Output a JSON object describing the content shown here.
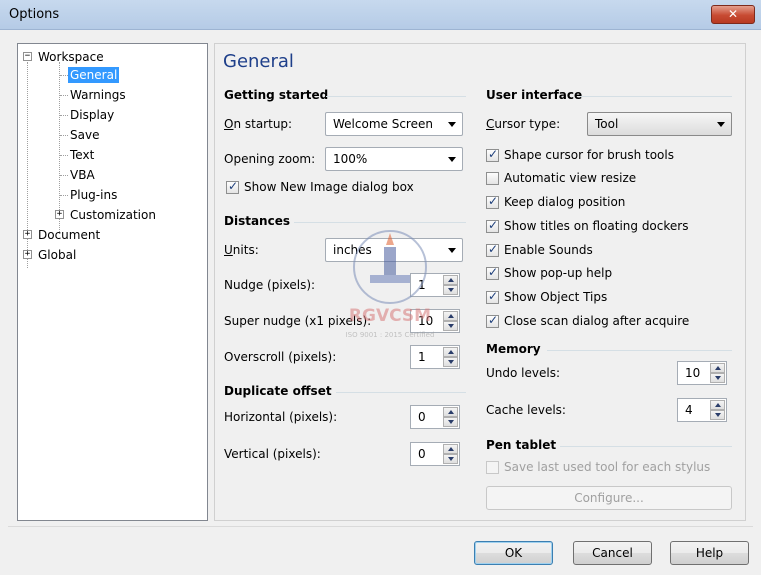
{
  "window": {
    "title": "Options",
    "close_glyph": "✕"
  },
  "tree": {
    "items": [
      {
        "label": "Workspace",
        "expander": "−"
      },
      {
        "label": "General"
      },
      {
        "label": "Warnings"
      },
      {
        "label": "Display"
      },
      {
        "label": "Save"
      },
      {
        "label": "Text"
      },
      {
        "label": "VBA"
      },
      {
        "label": "Plug-ins"
      },
      {
        "label": "Customization",
        "expander": "+"
      },
      {
        "label": "Document",
        "expander": "+"
      },
      {
        "label": "Global",
        "expander": "+"
      }
    ],
    "selected": "General"
  },
  "panel": {
    "title": "General",
    "getting_started": {
      "title": "Getting started",
      "on_startup_label": "On startup:",
      "on_startup_value": "Welcome Screen",
      "opening_zoom_label": "Opening zoom:",
      "opening_zoom_value": "100%",
      "show_new_image_label": "Show New Image dialog box",
      "show_new_image_checked": true
    },
    "distances": {
      "title": "Distances",
      "units_label": "Units:",
      "units_value": "inches",
      "nudge_label": "Nudge (pixels):",
      "nudge_value": "1",
      "super_nudge_label": "Super nudge (x1 pixels):",
      "super_nudge_value": "10",
      "overscroll_label": "Overscroll (pixels):",
      "overscroll_value": "1"
    },
    "duplicate_offset": {
      "title": "Duplicate offset",
      "horizontal_label": "Horizontal (pixels):",
      "horizontal_value": "0",
      "vertical_label": "Vertical (pixels):",
      "vertical_value": "0"
    },
    "user_interface": {
      "title": "User interface",
      "cursor_type_label": "Cursor type:",
      "cursor_type_value": "Tool",
      "checkboxes": [
        {
          "label": "Shape cursor for brush tools",
          "checked": true
        },
        {
          "label": "Automatic view resize",
          "checked": false
        },
        {
          "label": "Keep dialog position",
          "checked": true
        },
        {
          "label": "Show titles on floating dockers",
          "checked": true
        },
        {
          "label": "Enable Sounds",
          "checked": true
        },
        {
          "label": "Show pop-up help",
          "checked": true
        },
        {
          "label": "Show Object Tips",
          "checked": true
        },
        {
          "label": "Close scan dialog after acquire",
          "checked": true
        }
      ]
    },
    "memory": {
      "title": "Memory",
      "undo_label": "Undo levels:",
      "undo_value": "10",
      "cache_label": "Cache levels:",
      "cache_value": "4"
    },
    "pen_tablet": {
      "title": "Pen tablet",
      "save_last_label": "Save last used tool for each stylus",
      "configure_label": "Configure..."
    }
  },
  "watermark": {
    "text": "RGVCSM",
    "subtext": "ISO 9001 : 2015 Certified"
  },
  "footer": {
    "ok_label": "OK",
    "cancel_label": "Cancel",
    "help_label": "Help"
  }
}
